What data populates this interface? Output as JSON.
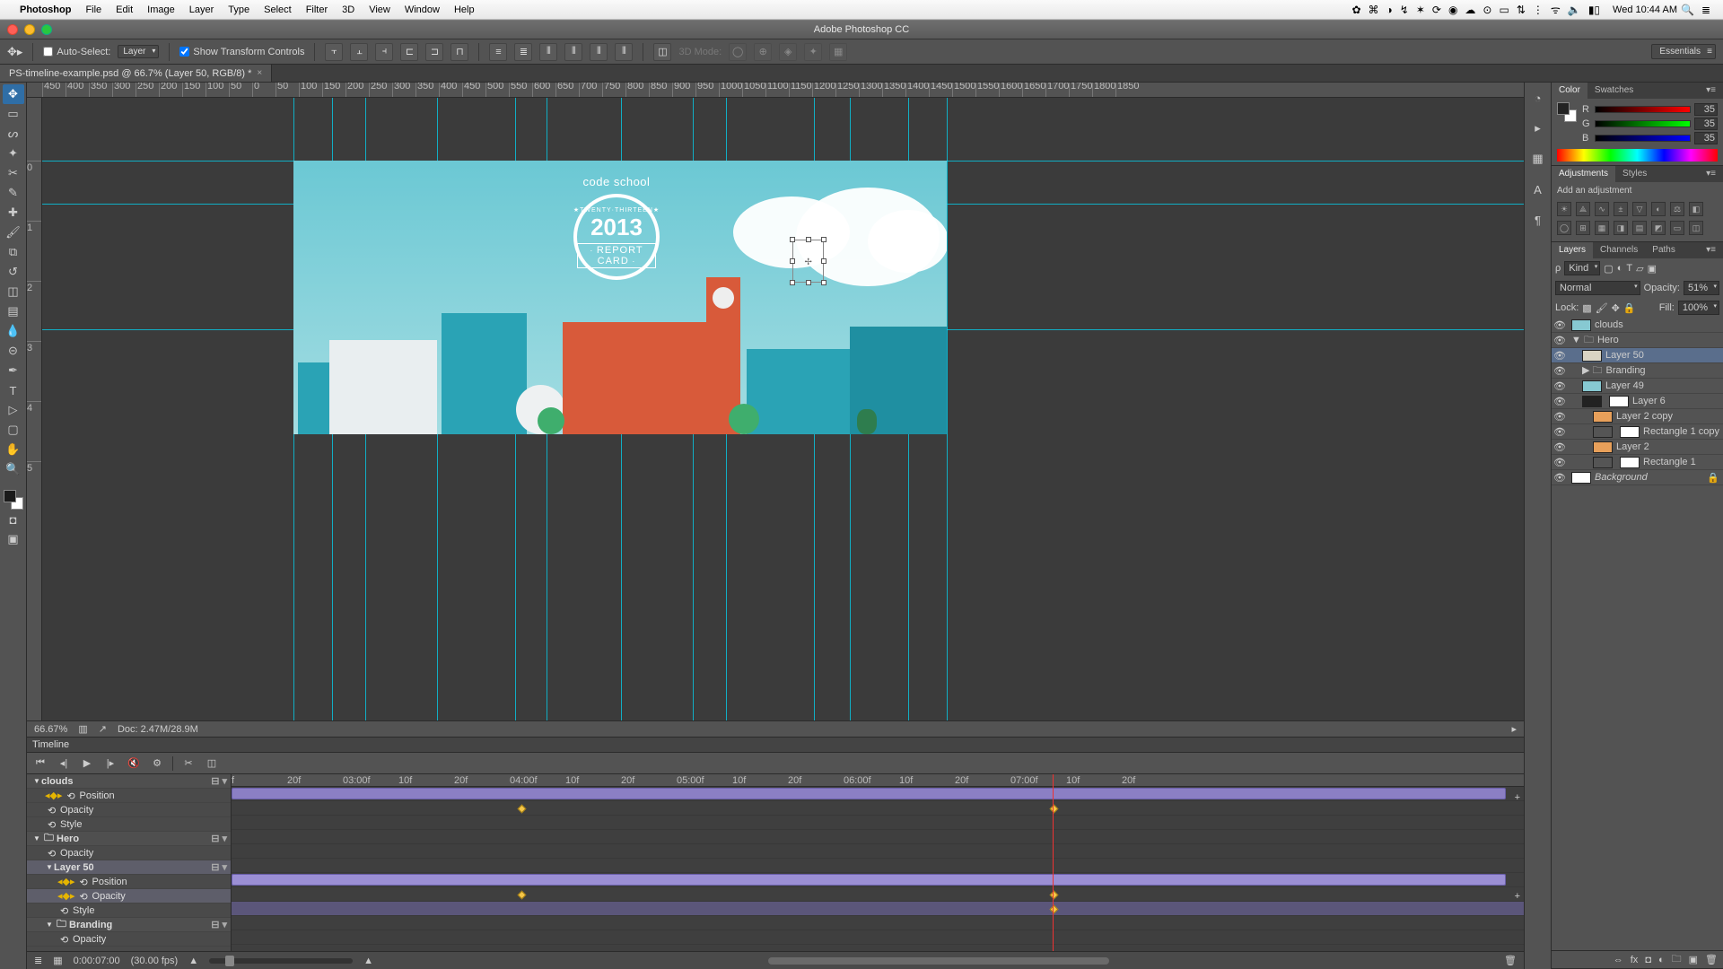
{
  "mac_menubar": {
    "app": "Photoshop",
    "items": [
      "File",
      "Edit",
      "Image",
      "Layer",
      "Type",
      "Select",
      "Filter",
      "3D",
      "View",
      "Window",
      "Help"
    ],
    "clock": "Wed 10:44 AM"
  },
  "window_title": "Adobe Photoshop CC",
  "options_bar": {
    "autoselect_label": "Auto-Select:",
    "autoselect_target": "Layer",
    "show_transform": "Show Transform Controls",
    "threed_mode": "3D Mode:",
    "workspace": "Essentials"
  },
  "document_tab": "PS-timeline-example.psd @ 66.7% (Layer 50, RGB/8) *",
  "ruler_marks": [
    -450,
    -400,
    -350,
    -300,
    -250,
    -200,
    -150,
    -100,
    -50,
    0,
    50,
    100,
    150,
    200,
    250,
    300,
    350,
    400,
    450,
    500,
    550,
    600,
    650,
    700,
    750,
    800,
    850,
    900,
    950,
    1000,
    1050,
    1100,
    1150,
    1200,
    1250,
    1300,
    1350,
    1400,
    1450,
    1500,
    1550,
    1600,
    1650,
    1700,
    1750,
    1800,
    1850
  ],
  "v_ruler_marks": [
    0,
    1,
    2,
    3,
    4,
    5
  ],
  "statusbar": {
    "zoom": "66.67%",
    "doc": "Doc: 2.47M/28.9M"
  },
  "timeline": {
    "tab": "Timeline",
    "timemarks": [
      "f",
      "20f",
      "03:00f",
      "10f",
      "20f",
      "04:00f",
      "10f",
      "20f",
      "05:00f",
      "10f",
      "20f",
      "06:00f",
      "10f",
      "20f",
      "07:00f",
      "10f",
      "20f"
    ],
    "tracks_left": [
      {
        "type": "group",
        "label": "clouds",
        "indent": 0,
        "expanded": true
      },
      {
        "type": "prop",
        "label": "Position",
        "indent": 1,
        "key": true
      },
      {
        "type": "prop",
        "label": "Opacity",
        "indent": 1
      },
      {
        "type": "prop",
        "label": "Style",
        "indent": 1
      },
      {
        "type": "group",
        "label": "Hero",
        "indent": 0,
        "expanded": true,
        "folder": true
      },
      {
        "type": "prop",
        "label": "Opacity",
        "indent": 1
      },
      {
        "type": "group",
        "label": "Layer 50",
        "indent": 1,
        "expanded": true,
        "sel": true
      },
      {
        "type": "prop",
        "label": "Position",
        "indent": 2,
        "key": true
      },
      {
        "type": "prop",
        "label": "Opacity",
        "indent": 2,
        "key": true,
        "sel": true
      },
      {
        "type": "prop",
        "label": "Style",
        "indent": 2
      },
      {
        "type": "group",
        "label": "Branding",
        "indent": 1,
        "expanded": true,
        "folder": true
      },
      {
        "type": "prop",
        "label": "Opacity",
        "indent": 2
      }
    ],
    "footer_time": "0:00:07:00",
    "footer_fps": "(30.00 fps)"
  },
  "color_panel": {
    "tabs": [
      "Color",
      "Swatches"
    ],
    "channels": [
      {
        "l": "R",
        "v": "35"
      },
      {
        "l": "G",
        "v": "35"
      },
      {
        "l": "B",
        "v": "35"
      }
    ]
  },
  "adjustments_panel": {
    "tabs": [
      "Adjustments",
      "Styles"
    ],
    "heading": "Add an adjustment"
  },
  "layers_panel": {
    "tabs": [
      "Layers",
      "Channels",
      "Paths"
    ],
    "kind": "Kind",
    "blend": "Normal",
    "opacity_label": "Opacity:",
    "opacity_val": "51%",
    "lock_label": "Lock:",
    "layers": [
      {
        "name": "clouds",
        "indent": 0,
        "thumb": "#87c9d2"
      },
      {
        "name": "Hero",
        "indent": 0,
        "folder": true,
        "expanded": true
      },
      {
        "name": "Layer 50",
        "indent": 1,
        "sel": true,
        "thumb": "#d9d4c4"
      },
      {
        "name": "Branding",
        "indent": 1,
        "folder": true
      },
      {
        "name": "Layer 49",
        "indent": 1,
        "thumb": "#87c9d2"
      },
      {
        "name": "Layer 6",
        "indent": 1,
        "thumb": "#222",
        "mask": true
      },
      {
        "name": "Layer 2 copy",
        "indent": 2,
        "thumb": "#e8a05a"
      },
      {
        "name": "Rectangle 1 copy",
        "indent": 2,
        "shape": true
      },
      {
        "name": "Layer 2",
        "indent": 2,
        "thumb": "#e8a05a"
      },
      {
        "name": "Rectangle 1",
        "indent": 2,
        "shape": true
      },
      {
        "name": "Background",
        "indent": 0,
        "thumb": "#fff",
        "locked": true,
        "italic": true
      }
    ]
  },
  "canvas_art": {
    "brand_top": "code school",
    "year": "2013",
    "report": "REPORT CARD"
  }
}
